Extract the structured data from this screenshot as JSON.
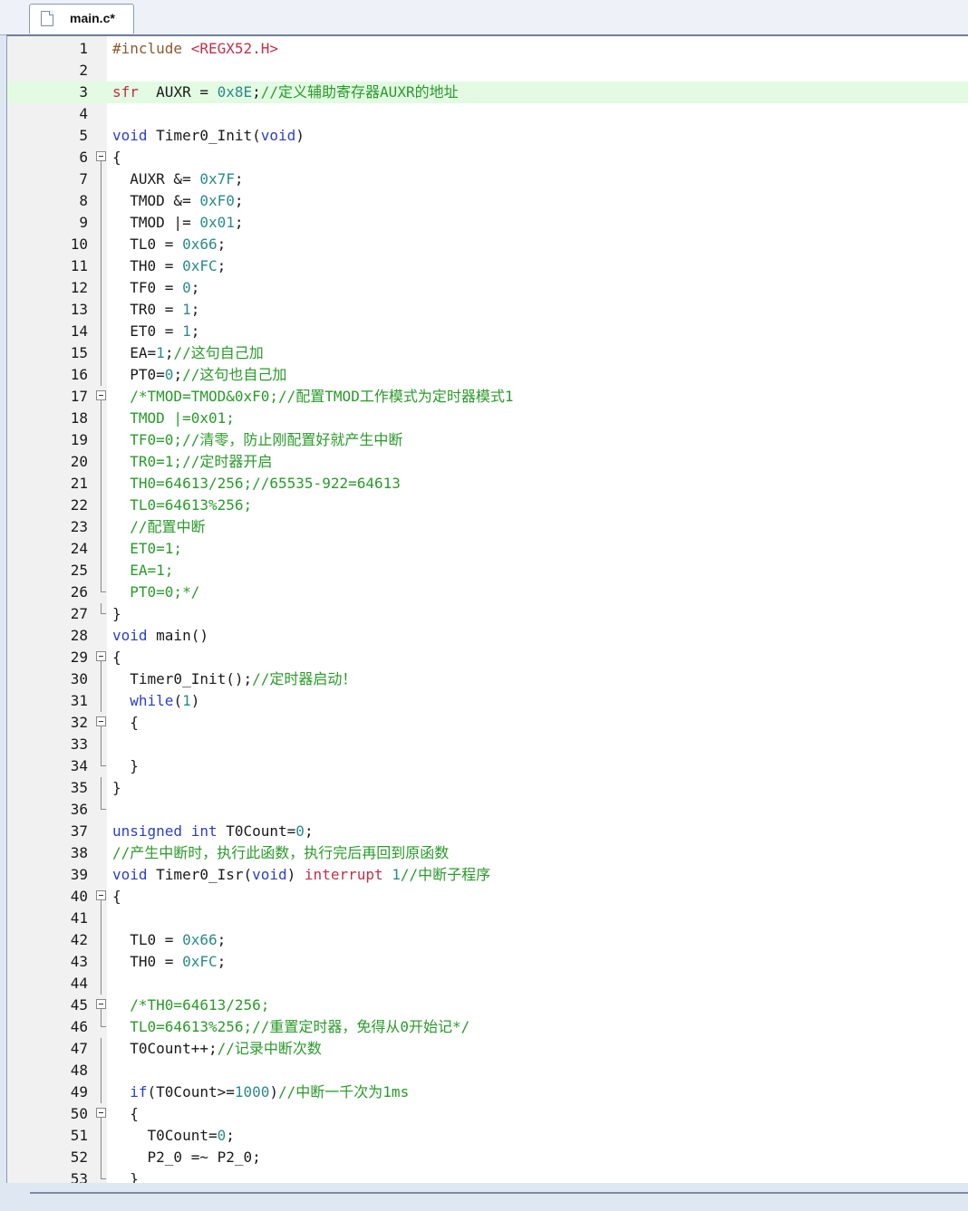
{
  "tab": {
    "label": "main.c*"
  },
  "lines": [
    {
      "n": "1",
      "parts": [
        [
          "pp",
          "#include "
        ],
        [
          "red",
          "<REGX52.H>"
        ]
      ]
    },
    {
      "n": "2",
      "parts": []
    },
    {
      "n": "3",
      "hl": true,
      "parts": [
        [
          "red",
          "sfr"
        ],
        [
          "",
          "  AUXR = "
        ],
        [
          "num",
          "0x8E"
        ],
        [
          "",
          ";"
        ],
        [
          "cm",
          "//定义辅助寄存器AUXR的地址"
        ]
      ]
    },
    {
      "n": "4",
      "parts": []
    },
    {
      "n": "5",
      "parts": [
        [
          "kw",
          "void"
        ],
        [
          "",
          " Timer0_Init("
        ],
        [
          "kw",
          "void"
        ],
        [
          "",
          ")"
        ]
      ]
    },
    {
      "n": "6",
      "fold": "open",
      "parts": [
        [
          "",
          "{"
        ]
      ]
    },
    {
      "n": "7",
      "fold": "v",
      "parts": [
        [
          "",
          "  AUXR &= "
        ],
        [
          "num",
          "0x7F"
        ],
        [
          "",
          ";"
        ]
      ]
    },
    {
      "n": "8",
      "fold": "v",
      "parts": [
        [
          "",
          "  TMOD &= "
        ],
        [
          "num",
          "0xF0"
        ],
        [
          "",
          ";"
        ]
      ]
    },
    {
      "n": "9",
      "fold": "v",
      "parts": [
        [
          "",
          "  TMOD |= "
        ],
        [
          "num",
          "0x01"
        ],
        [
          "",
          ";"
        ]
      ]
    },
    {
      "n": "10",
      "fold": "v",
      "parts": [
        [
          "",
          "  TL0 = "
        ],
        [
          "num",
          "0x66"
        ],
        [
          "",
          ";"
        ]
      ]
    },
    {
      "n": "11",
      "fold": "v",
      "parts": [
        [
          "",
          "  TH0 = "
        ],
        [
          "num",
          "0xFC"
        ],
        [
          "",
          ";"
        ]
      ]
    },
    {
      "n": "12",
      "fold": "v",
      "parts": [
        [
          "",
          "  TF0 = "
        ],
        [
          "num",
          "0"
        ],
        [
          "",
          ";"
        ]
      ]
    },
    {
      "n": "13",
      "fold": "v",
      "parts": [
        [
          "",
          "  TR0 = "
        ],
        [
          "num",
          "1"
        ],
        [
          "",
          ";"
        ]
      ]
    },
    {
      "n": "14",
      "fold": "v",
      "parts": [
        [
          "",
          "  ET0 = "
        ],
        [
          "num",
          "1"
        ],
        [
          "",
          ";"
        ]
      ]
    },
    {
      "n": "15",
      "fold": "v",
      "parts": [
        [
          "",
          "  EA="
        ],
        [
          "num",
          "1"
        ],
        [
          "",
          ";"
        ],
        [
          "cm",
          "//这句自己加"
        ]
      ]
    },
    {
      "n": "16",
      "fold": "v",
      "parts": [
        [
          "",
          "  PT0="
        ],
        [
          "num",
          "0"
        ],
        [
          "",
          ";"
        ],
        [
          "cm",
          "//这句也自己加"
        ]
      ]
    },
    {
      "n": "17",
      "fold": "open",
      "parts": [
        [
          "cm",
          "  /*TMOD=TMOD&0xF0;//配置TMOD工作模式为定时器模式1"
        ]
      ]
    },
    {
      "n": "18",
      "fold": "v",
      "parts": [
        [
          "cm",
          "  TMOD |=0x01;"
        ]
      ]
    },
    {
      "n": "19",
      "fold": "v",
      "parts": [
        [
          "cm",
          "  TF0=0;//清零，防止刚配置好就产生中断"
        ]
      ]
    },
    {
      "n": "20",
      "fold": "v",
      "parts": [
        [
          "cm",
          "  TR0=1;//定时器开启"
        ]
      ]
    },
    {
      "n": "21",
      "fold": "v",
      "parts": [
        [
          "cm",
          "  TH0=64613/256;//65535-922=64613"
        ]
      ]
    },
    {
      "n": "22",
      "fold": "v",
      "parts": [
        [
          "cm",
          "  TL0=64613%256;"
        ]
      ]
    },
    {
      "n": "23",
      "fold": "v",
      "parts": [
        [
          "cm",
          "  //配置中断"
        ]
      ]
    },
    {
      "n": "24",
      "fold": "v",
      "parts": [
        [
          "cm",
          "  ET0=1;"
        ]
      ]
    },
    {
      "n": "25",
      "fold": "v",
      "parts": [
        [
          "cm",
          "  EA=1;"
        ]
      ]
    },
    {
      "n": "26",
      "fold": "end",
      "parts": [
        [
          "cm",
          "  PT0=0;*/"
        ]
      ]
    },
    {
      "n": "27",
      "fold": "end",
      "parts": [
        [
          "",
          "}"
        ]
      ]
    },
    {
      "n": "28",
      "parts": [
        [
          "kw",
          "void"
        ],
        [
          "",
          " main()"
        ]
      ]
    },
    {
      "n": "29",
      "fold": "open",
      "parts": [
        [
          "",
          "{"
        ]
      ]
    },
    {
      "n": "30",
      "fold": "v",
      "parts": [
        [
          "",
          "  Timer0_Init();"
        ],
        [
          "cm",
          "//定时器启动！"
        ]
      ]
    },
    {
      "n": "31",
      "fold": "v",
      "parts": [
        [
          "kw",
          "  while"
        ],
        [
          "",
          "("
        ],
        [
          "num",
          "1"
        ],
        [
          "",
          ")"
        ]
      ]
    },
    {
      "n": "32",
      "fold": "open",
      "parts": [
        [
          "",
          "  {"
        ]
      ]
    },
    {
      "n": "33",
      "fold": "v",
      "parts": []
    },
    {
      "n": "34",
      "fold": "end",
      "parts": [
        [
          "",
          "  }"
        ]
      ]
    },
    {
      "n": "35",
      "fold": "v",
      "parts": [
        [
          "",
          "}"
        ]
      ]
    },
    {
      "n": "36",
      "fold": "end",
      "parts": []
    },
    {
      "n": "37",
      "parts": [
        [
          "kw",
          "unsigned int"
        ],
        [
          "",
          " T0Count="
        ],
        [
          "num",
          "0"
        ],
        [
          "",
          ";"
        ]
      ]
    },
    {
      "n": "38",
      "parts": [
        [
          "cm",
          "//产生中断时，执行此函数，执行完后再回到原函数"
        ]
      ]
    },
    {
      "n": "39",
      "parts": [
        [
          "kw",
          "void"
        ],
        [
          "",
          " Timer0_Isr("
        ],
        [
          "kw",
          "void"
        ],
        [
          "",
          ") "
        ],
        [
          "red",
          "interrupt"
        ],
        [
          "",
          " "
        ],
        [
          "num",
          "1"
        ],
        [
          "cm",
          "//中断子程序"
        ]
      ]
    },
    {
      "n": "40",
      "fold": "open",
      "parts": [
        [
          "",
          "{"
        ]
      ]
    },
    {
      "n": "41",
      "fold": "v",
      "parts": []
    },
    {
      "n": "42",
      "fold": "v",
      "parts": [
        [
          "",
          "  TL0 = "
        ],
        [
          "num",
          "0x66"
        ],
        [
          "",
          ";"
        ]
      ]
    },
    {
      "n": "43",
      "fold": "v",
      "parts": [
        [
          "",
          "  TH0 = "
        ],
        [
          "num",
          "0xFC"
        ],
        [
          "",
          ";"
        ]
      ]
    },
    {
      "n": "44",
      "fold": "v",
      "parts": []
    },
    {
      "n": "45",
      "fold": "open",
      "parts": [
        [
          "cm",
          "  /*TH0=64613/256;"
        ]
      ]
    },
    {
      "n": "46",
      "fold": "end",
      "parts": [
        [
          "cm",
          "  TL0=64613%256;//重置定时器，免得从0开始记*/"
        ]
      ]
    },
    {
      "n": "47",
      "fold": "v",
      "parts": [
        [
          "",
          "  T0Count++;"
        ],
        [
          "cm",
          "//记录中断次数"
        ]
      ]
    },
    {
      "n": "48",
      "fold": "v",
      "parts": []
    },
    {
      "n": "49",
      "fold": "v",
      "parts": [
        [
          "kw",
          "  if"
        ],
        [
          "",
          "(T0Count>="
        ],
        [
          "num",
          "1000"
        ],
        [
          "",
          ")"
        ],
        [
          "cm",
          "//中断一千次为1ms"
        ]
      ]
    },
    {
      "n": "50",
      "fold": "open",
      "parts": [
        [
          "",
          "  {"
        ]
      ]
    },
    {
      "n": "51",
      "fold": "v",
      "parts": [
        [
          "",
          "    T0Count="
        ],
        [
          "num",
          "0"
        ],
        [
          "",
          ";"
        ]
      ]
    },
    {
      "n": "52",
      "fold": "v",
      "parts": [
        [
          "",
          "    P2_0 =~ P2_0;"
        ]
      ]
    },
    {
      "n": "53",
      "fold": "end",
      "parts": [
        [
          "",
          "  }"
        ]
      ]
    }
  ]
}
